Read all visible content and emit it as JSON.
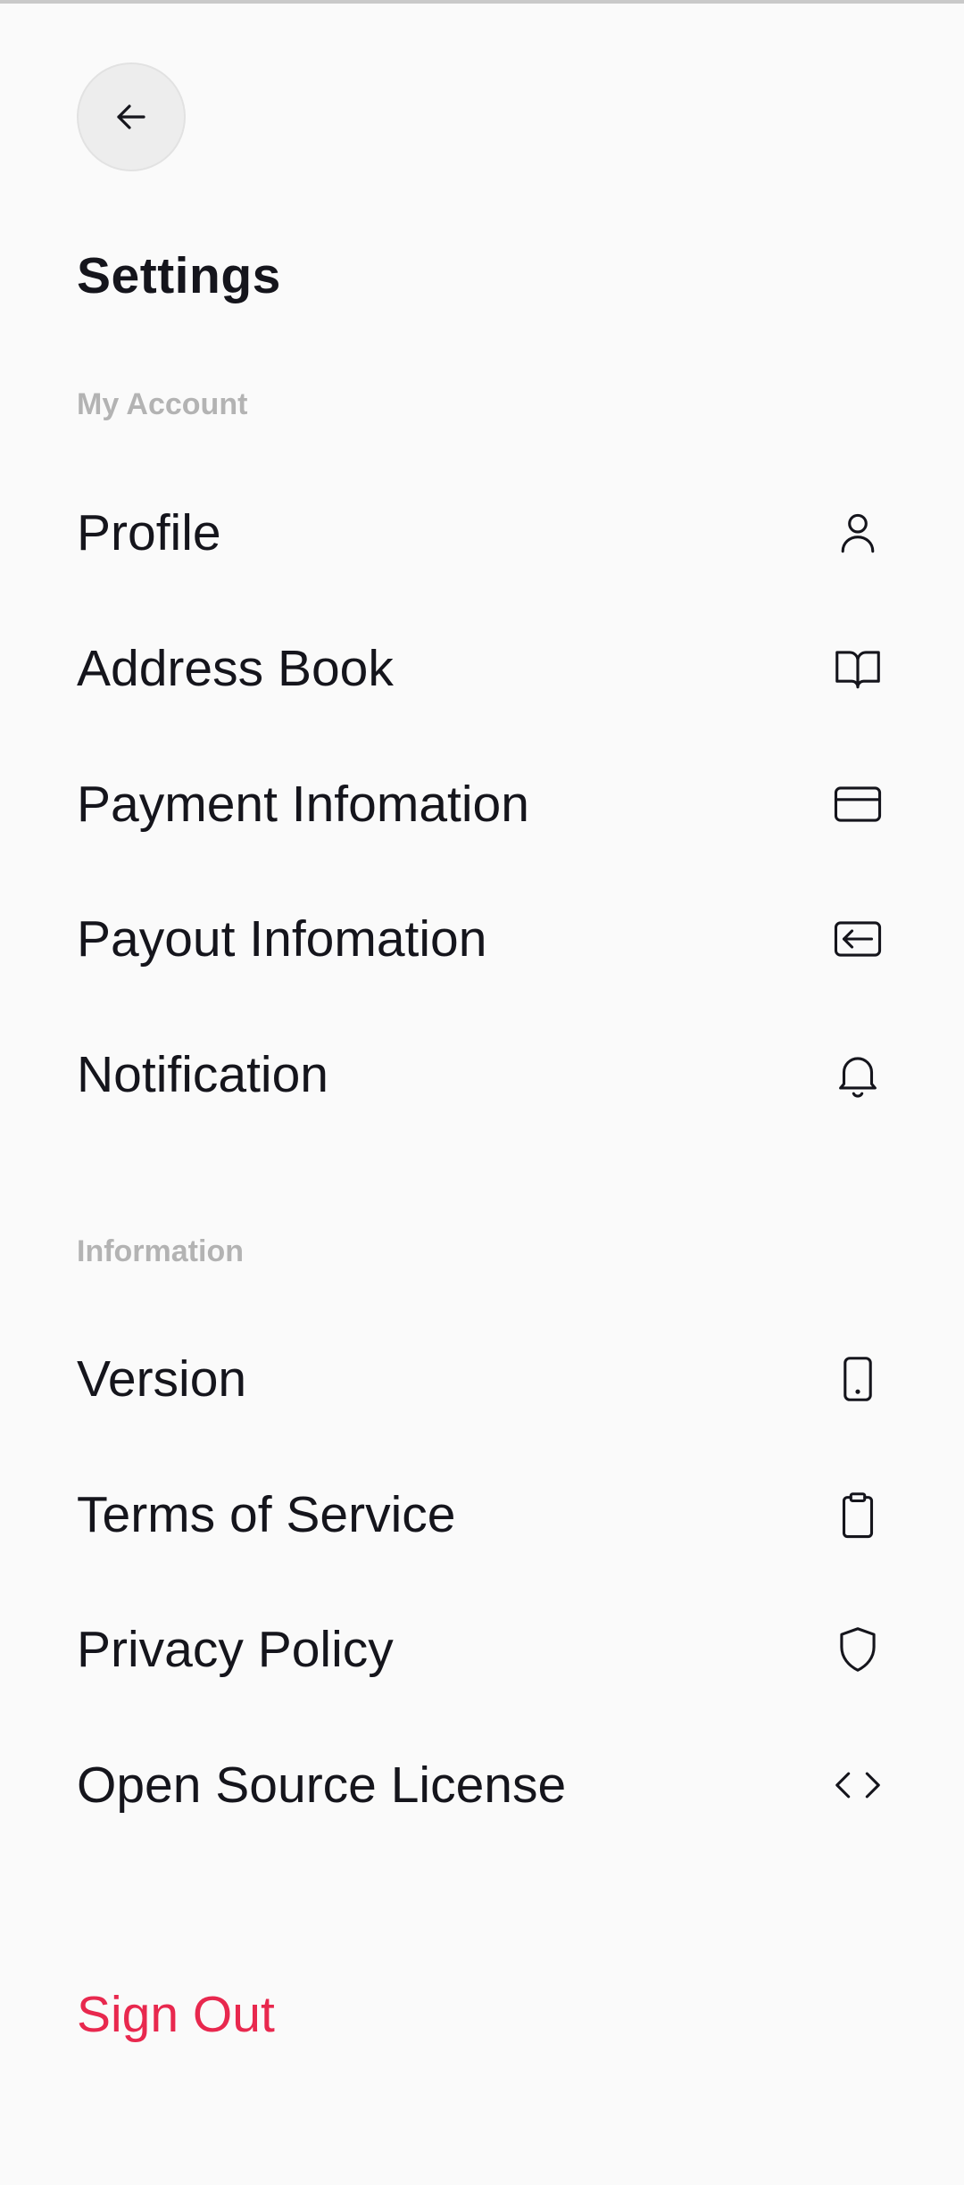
{
  "header": {
    "back_icon": "arrow-left-icon",
    "title": "Settings"
  },
  "sections": [
    {
      "label": "My Account",
      "items": [
        {
          "label": "Profile",
          "icon": "user-icon"
        },
        {
          "label": "Address Book",
          "icon": "book-icon"
        },
        {
          "label": "Payment Infomation",
          "icon": "credit-card-icon"
        },
        {
          "label": "Payout Infomation",
          "icon": "payout-icon"
        },
        {
          "label": "Notification",
          "icon": "bell-icon"
        }
      ]
    },
    {
      "label": "Information",
      "items": [
        {
          "label": "Version",
          "icon": "phone-icon"
        },
        {
          "label": "Terms of Service",
          "icon": "clipboard-icon"
        },
        {
          "label": "Privacy Policy",
          "icon": "shield-icon"
        },
        {
          "label": "Open Source License",
          "icon": "code-icon"
        }
      ]
    }
  ],
  "sign_out": {
    "label": "Sign Out",
    "color": "#e8284e"
  },
  "colors": {
    "background": "#fafafa",
    "text": "#15151c",
    "section_label": "#b3b3b3"
  }
}
